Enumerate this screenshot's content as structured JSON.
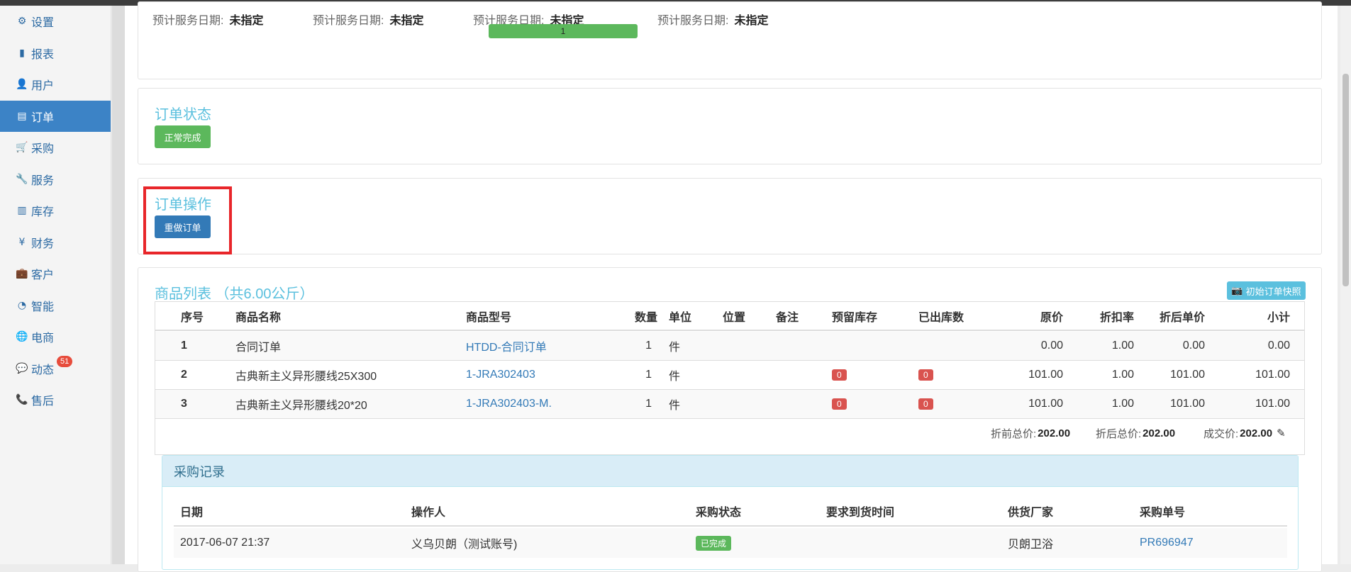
{
  "sidebar": {
    "items": [
      {
        "label": "设置",
        "icon": "⚙"
      },
      {
        "label": "报表",
        "icon": "▮"
      },
      {
        "label": "用户",
        "icon": "👤"
      },
      {
        "label": "订单",
        "icon": "▤"
      },
      {
        "label": "采购",
        "icon": "🛒"
      },
      {
        "label": "服务",
        "icon": "🔧"
      },
      {
        "label": "库存",
        "icon": "▥"
      },
      {
        "label": "财务",
        "icon": "¥"
      },
      {
        "label": "客户",
        "icon": "💼"
      },
      {
        "label": "智能",
        "icon": "◔"
      },
      {
        "label": "电商",
        "icon": "🌐"
      },
      {
        "label": "动态",
        "icon": "💬",
        "badge": "51"
      },
      {
        "label": "售后",
        "icon": "📞"
      }
    ],
    "active_index": 3
  },
  "service_dates": {
    "items": [
      {
        "label": "预计服务日期:",
        "value": "未指定"
      },
      {
        "label": "预计服务日期:",
        "value": "未指定"
      },
      {
        "label": "预计服务日期:",
        "value": "未指定"
      },
      {
        "label": "预计服务日期:",
        "value": "未指定"
      }
    ],
    "progress_label": "1"
  },
  "order_status": {
    "title": "订单状态",
    "status_label": "正常完成"
  },
  "order_ops": {
    "title": "订单操作",
    "redo_label": "重做订单"
  },
  "products": {
    "title": "商品列表 （共6.00公斤）",
    "snapshot_label": "初始订单快照",
    "headers": [
      "序号",
      "商品名称",
      "商品型号",
      "数量",
      "单位",
      "位置",
      "备注",
      "预留库存",
      "已出库数",
      "原价",
      "折扣率",
      "折后单价",
      "小计"
    ],
    "rows": [
      {
        "no": "1",
        "name": "合同订单",
        "model": "HTDD-合同订单",
        "qty": "1",
        "unit": "件",
        "reserved": "",
        "out": "",
        "price": "0.00",
        "discount": "1.00",
        "unit_price": "0.00",
        "subtotal": "0.00"
      },
      {
        "no": "2",
        "name": "古典新主义异形腰线25X300",
        "model": "1-JRA302403",
        "qty": "1",
        "unit": "件",
        "reserved": "0",
        "out": "0",
        "price": "101.00",
        "discount": "1.00",
        "unit_price": "101.00",
        "subtotal": "101.00"
      },
      {
        "no": "3",
        "name": "古典新主义异形腰线20*20",
        "model": "1-JRA302403-M.",
        "qty": "1",
        "unit": "件",
        "reserved": "0",
        "out": "0",
        "price": "101.00",
        "discount": "1.00",
        "unit_price": "101.00",
        "subtotal": "101.00"
      }
    ],
    "totals": {
      "before_label": "折前总价:",
      "before_value": "202.00",
      "after_label": "折后总价:",
      "after_value": "202.00",
      "deal_label": "成交价:",
      "deal_value": "202.00"
    }
  },
  "purchase": {
    "title": "采购记录",
    "headers": [
      "日期",
      "操作人",
      "采购状态",
      "要求到货时间",
      "供货厂家",
      "采购单号"
    ],
    "rows": [
      {
        "date": "2017-06-07 21:37",
        "operator": "义乌贝朗（测试账号)",
        "status": "已完成",
        "arrival": "",
        "supplier": "贝朗卫浴",
        "po": "PR696947"
      }
    ]
  },
  "colors": {
    "accent": "#3c83c6",
    "title": "#5bc0de",
    "success": "#5cb85c",
    "danger": "#d9534f",
    "highlight": "#e8262a"
  }
}
